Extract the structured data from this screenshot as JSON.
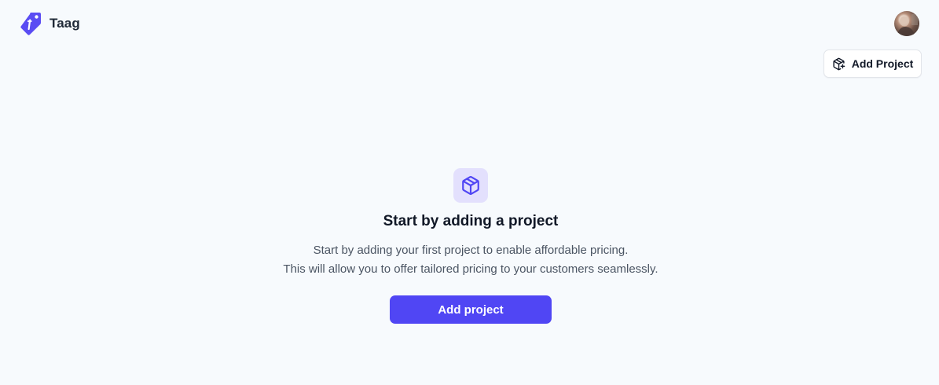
{
  "header": {
    "brand_name": "Taag",
    "logo_icon": "price-tag-icon",
    "avatar_icon": "user-avatar",
    "add_project_label": "Add Project",
    "add_project_icon": "package-plus-icon"
  },
  "empty_state": {
    "icon": "package-icon",
    "title": "Start by adding a project",
    "description_line_1": "Start by adding your first project to enable affordable pricing.",
    "description_line_2": "This will allow you to offer tailored pricing to your customers seamlessly.",
    "cta_label": "Add project"
  },
  "colors": {
    "background": "#f7fafd",
    "accent": "#5046f4",
    "icon_tile": "#e3e0fd",
    "text_primary": "#111827",
    "text_secondary": "#4b5563"
  }
}
